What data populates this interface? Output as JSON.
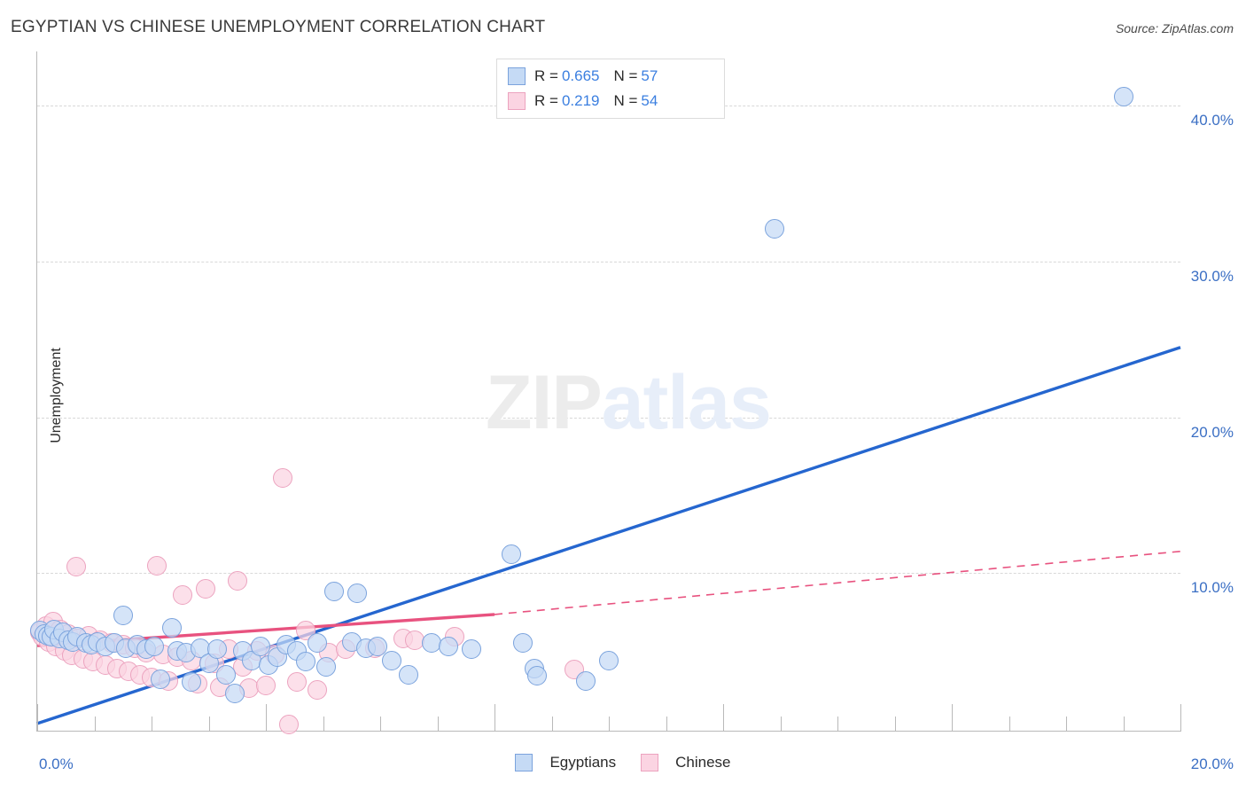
{
  "header": {
    "title": "EGYPTIAN VS CHINESE UNEMPLOYMENT CORRELATION CHART",
    "source": "Source: ZipAtlas.com"
  },
  "stats": {
    "rows": [
      {
        "series": "Egyptians",
        "r_label": "R =",
        "r_value": "0.665",
        "n_label": "N =",
        "n_value": "57",
        "color": "#c5daf5"
      },
      {
        "series": "Chinese",
        "r_label": "R =",
        "r_value": "0.219",
        "n_label": "N =",
        "n_value": "54",
        "color": "#fbd4e2"
      }
    ]
  },
  "legend": {
    "items": [
      {
        "label": "Egyptians",
        "color": "#c5daf5"
      },
      {
        "label": "Chinese",
        "color": "#fbd4e2"
      }
    ]
  },
  "watermark": {
    "part1": "ZIP",
    "part2": "atlas"
  },
  "axes": {
    "y_title": "Unemployment",
    "y_ticks": [
      "40.0%",
      "30.0%",
      "20.0%",
      "10.0%"
    ],
    "x_min_label": "0.0%",
    "x_max_label": "20.0%"
  },
  "chart_data": {
    "type": "scatter",
    "title": "EGYPTIAN VS CHINESE UNEMPLOYMENT CORRELATION CHART",
    "xlabel": "",
    "ylabel": "Unemployment",
    "xlim": [
      0.0,
      20.0
    ],
    "ylim": [
      0.0,
      43.5
    ],
    "x_unit": "%",
    "y_unit": "%",
    "grid": true,
    "legend_position": "bottom-center",
    "y_tick_values": [
      10.0,
      20.0,
      30.0,
      40.0
    ],
    "x_tick_values": [
      0.0,
      20.0
    ],
    "series": [
      {
        "name": "Egyptians",
        "color": "#c5daf5",
        "border": "#7ba3dd",
        "R": 0.665,
        "N": 57,
        "trendline": {
          "style": "solid",
          "color": "#2566cf",
          "x0": 0.0,
          "y0": 0.35,
          "x1": 20.0,
          "y1": 24.5
        },
        "points": [
          [
            0.05,
            6.3
          ],
          [
            0.12,
            6.1
          ],
          [
            0.18,
            6.0
          ],
          [
            0.25,
            5.9
          ],
          [
            0.3,
            6.4
          ],
          [
            0.38,
            5.8
          ],
          [
            0.45,
            6.2
          ],
          [
            0.55,
            5.7
          ],
          [
            0.62,
            5.6
          ],
          [
            0.7,
            5.9
          ],
          [
            0.85,
            5.5
          ],
          [
            0.95,
            5.4
          ],
          [
            1.05,
            5.6
          ],
          [
            1.2,
            5.3
          ],
          [
            1.35,
            5.5
          ],
          [
            1.5,
            7.3
          ],
          [
            1.55,
            5.2
          ],
          [
            1.75,
            5.4
          ],
          [
            1.9,
            5.1
          ],
          [
            2.05,
            5.3
          ],
          [
            2.15,
            3.2
          ],
          [
            2.35,
            6.5
          ],
          [
            2.45,
            5.0
          ],
          [
            2.6,
            4.9
          ],
          [
            2.7,
            3.0
          ],
          [
            2.85,
            5.2
          ],
          [
            3.0,
            4.2
          ],
          [
            3.15,
            5.1
          ],
          [
            3.3,
            3.5
          ],
          [
            3.45,
            2.3
          ],
          [
            3.6,
            5.0
          ],
          [
            3.75,
            4.4
          ],
          [
            3.9,
            5.3
          ],
          [
            4.05,
            4.1
          ],
          [
            4.2,
            4.6
          ],
          [
            4.35,
            5.4
          ],
          [
            4.55,
            5.0
          ],
          [
            4.7,
            4.3
          ],
          [
            4.9,
            5.5
          ],
          [
            5.05,
            4.0
          ],
          [
            5.2,
            8.8
          ],
          [
            5.5,
            5.6
          ],
          [
            5.6,
            8.7
          ],
          [
            5.75,
            5.2
          ],
          [
            5.95,
            5.3
          ],
          [
            6.2,
            4.4
          ],
          [
            6.5,
            3.5
          ],
          [
            6.9,
            5.5
          ],
          [
            7.2,
            5.3
          ],
          [
            7.6,
            5.1
          ],
          [
            8.3,
            11.2
          ],
          [
            8.5,
            5.5
          ],
          [
            8.7,
            3.9
          ],
          [
            8.75,
            3.4
          ],
          [
            9.6,
            3.1
          ],
          [
            10.0,
            4.4
          ],
          [
            12.9,
            32.1
          ],
          [
            19.0,
            40.6
          ]
        ]
      },
      {
        "name": "Chinese",
        "color": "#fbd4e2",
        "border": "#eca3bf",
        "R": 0.219,
        "N": 54,
        "trendline": {
          "style": "solid-then-dashed",
          "color": "#e8527f",
          "x0": 0.0,
          "y0": 5.35,
          "x1": 8.0,
          "y1": 7.35,
          "x_dash_end": 20.0,
          "y_dash_end": 11.4
        },
        "points": [
          [
            0.05,
            6.2
          ],
          [
            0.1,
            5.9
          ],
          [
            0.15,
            6.6
          ],
          [
            0.2,
            5.6
          ],
          [
            0.28,
            6.9
          ],
          [
            0.32,
            5.3
          ],
          [
            0.4,
            6.4
          ],
          [
            0.48,
            5.0
          ],
          [
            0.55,
            6.1
          ],
          [
            0.6,
            4.7
          ],
          [
            0.68,
            10.4
          ],
          [
            0.72,
            5.8
          ],
          [
            0.8,
            4.5
          ],
          [
            0.9,
            6.0
          ],
          [
            0.98,
            4.3
          ],
          [
            1.1,
            5.7
          ],
          [
            1.2,
            4.1
          ],
          [
            1.3,
            5.5
          ],
          [
            1.4,
            3.9
          ],
          [
            1.5,
            5.4
          ],
          [
            1.6,
            3.7
          ],
          [
            1.7,
            5.2
          ],
          [
            1.8,
            3.5
          ],
          [
            1.9,
            4.9
          ],
          [
            2.0,
            3.3
          ],
          [
            2.1,
            10.5
          ],
          [
            2.2,
            4.8
          ],
          [
            2.3,
            3.1
          ],
          [
            2.45,
            4.6
          ],
          [
            2.55,
            8.6
          ],
          [
            2.7,
            4.4
          ],
          [
            2.8,
            2.9
          ],
          [
            2.95,
            9.0
          ],
          [
            3.1,
            4.2
          ],
          [
            3.2,
            2.7
          ],
          [
            3.35,
            5.1
          ],
          [
            3.5,
            9.5
          ],
          [
            3.6,
            4.0
          ],
          [
            3.7,
            2.6
          ],
          [
            3.85,
            5.0
          ],
          [
            4.0,
            2.8
          ],
          [
            4.15,
            4.8
          ],
          [
            4.3,
            16.1
          ],
          [
            4.4,
            0.3
          ],
          [
            4.55,
            3.0
          ],
          [
            4.7,
            6.3
          ],
          [
            4.9,
            2.5
          ],
          [
            5.1,
            4.9
          ],
          [
            5.4,
            5.1
          ],
          [
            5.9,
            5.2
          ],
          [
            6.4,
            5.8
          ],
          [
            6.6,
            5.7
          ],
          [
            7.3,
            5.9
          ],
          [
            9.4,
            3.8
          ]
        ]
      }
    ]
  }
}
